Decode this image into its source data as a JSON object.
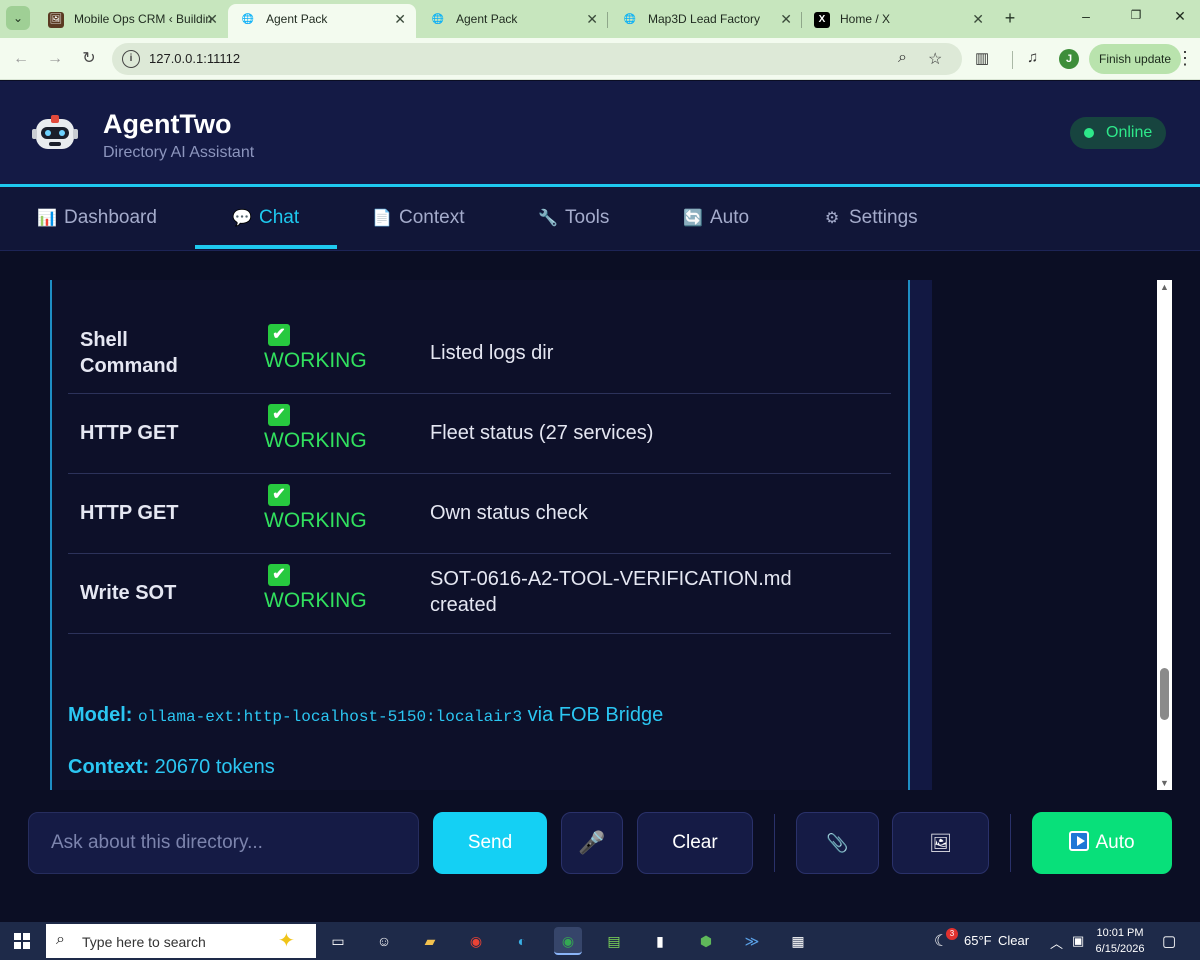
{
  "browser": {
    "tabs": [
      {
        "title": "Mobile Ops CRM ‹ Buildin",
        "fav": "🖼"
      },
      {
        "title": "Agent Pack",
        "fav": "🌐"
      },
      {
        "title": "Agent Pack",
        "fav": "🌐"
      },
      {
        "title": "Map3D Lead Factory",
        "fav": "🌐"
      },
      {
        "title": "Home / X",
        "fav": "X"
      }
    ],
    "url": "127.0.0.1:11112",
    "profile_initial": "J",
    "finish_update_label": "Finish update"
  },
  "app": {
    "name": "AgentTwo",
    "subtitle": "Directory AI Assistant",
    "status": "Online",
    "accent": "#1ec9ef",
    "status_color": "#2ee88a"
  },
  "nav": {
    "tabs": [
      {
        "label": "Dashboard",
        "icon": "📊"
      },
      {
        "label": "Chat",
        "icon": "💬"
      },
      {
        "label": "Context",
        "icon": "📄"
      },
      {
        "label": "Tools",
        "icon": "🔧"
      },
      {
        "label": "Auto",
        "icon": "🔄"
      },
      {
        "label": "Settings",
        "icon": "⚙"
      }
    ],
    "active": "Chat"
  },
  "chat": {
    "tool_rows": [
      {
        "tool": "Shell\nCommand",
        "check": "✔",
        "status": "WORKING",
        "result": "Listed logs dir"
      },
      {
        "tool": "HTTP GET",
        "check": "✔",
        "status": "WORKING",
        "result": "Fleet status (27 services)"
      },
      {
        "tool": "HTTP GET",
        "check": "✔",
        "status": "WORKING",
        "result": "Own status check"
      },
      {
        "tool": "Write SOT",
        "check": "✔",
        "status": "WORKING",
        "result": "SOT-0616-A2-TOOL-VERIFICATION.md\ncreated"
      }
    ],
    "model_label": "Model:",
    "model_value": "ollama-ext:http-localhost-5150:localair3",
    "model_suffix": " via FOB Bridge",
    "context_label": "Context:",
    "context_value": " 20670 tokens"
  },
  "input": {
    "placeholder": "Ask about this directory...",
    "value": "",
    "send_label": "Send",
    "mic_icon": "🎤",
    "clear_label": "Clear",
    "attach_icon": "📎",
    "image_icon": "🖼",
    "auto_label": "Auto"
  },
  "taskbar": {
    "search_placeholder": "Type here to search",
    "weather_temp": "65°F",
    "weather_text": "Clear",
    "weather_alerts": "3",
    "time": "10:01 PM",
    "date": "6/15/2026"
  }
}
